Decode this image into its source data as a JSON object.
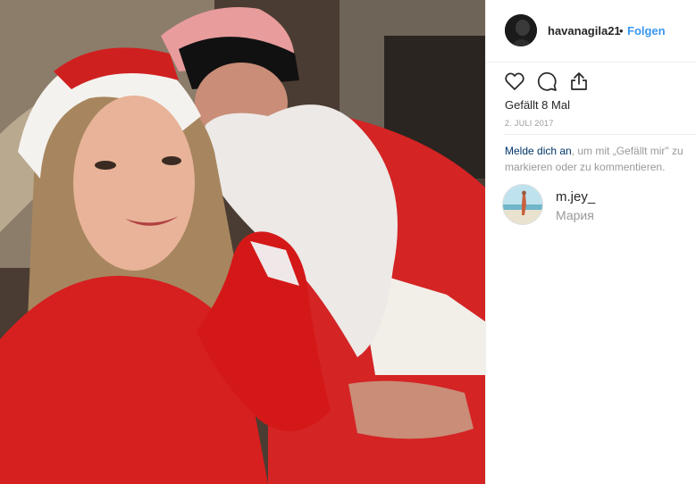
{
  "post": {
    "username": "havanagila21",
    "separator": "•",
    "follow_label": "Folgen",
    "likes_text": "Gefällt 8 Mal",
    "date_text": "2. JULI 2017",
    "login_link": "Melde dich an",
    "login_rest": ", um mit „Gefällt mir\" zu markieren oder zu kommentieren."
  },
  "icons": {
    "like": "heart-icon",
    "comment": "comment-icon",
    "share": "share-icon"
  },
  "comment": {
    "username": "m.jey_",
    "text": "Мария"
  },
  "colors": {
    "link": "#3897f0",
    "text": "#262626",
    "muted": "#999999",
    "login_link": "#003569"
  }
}
